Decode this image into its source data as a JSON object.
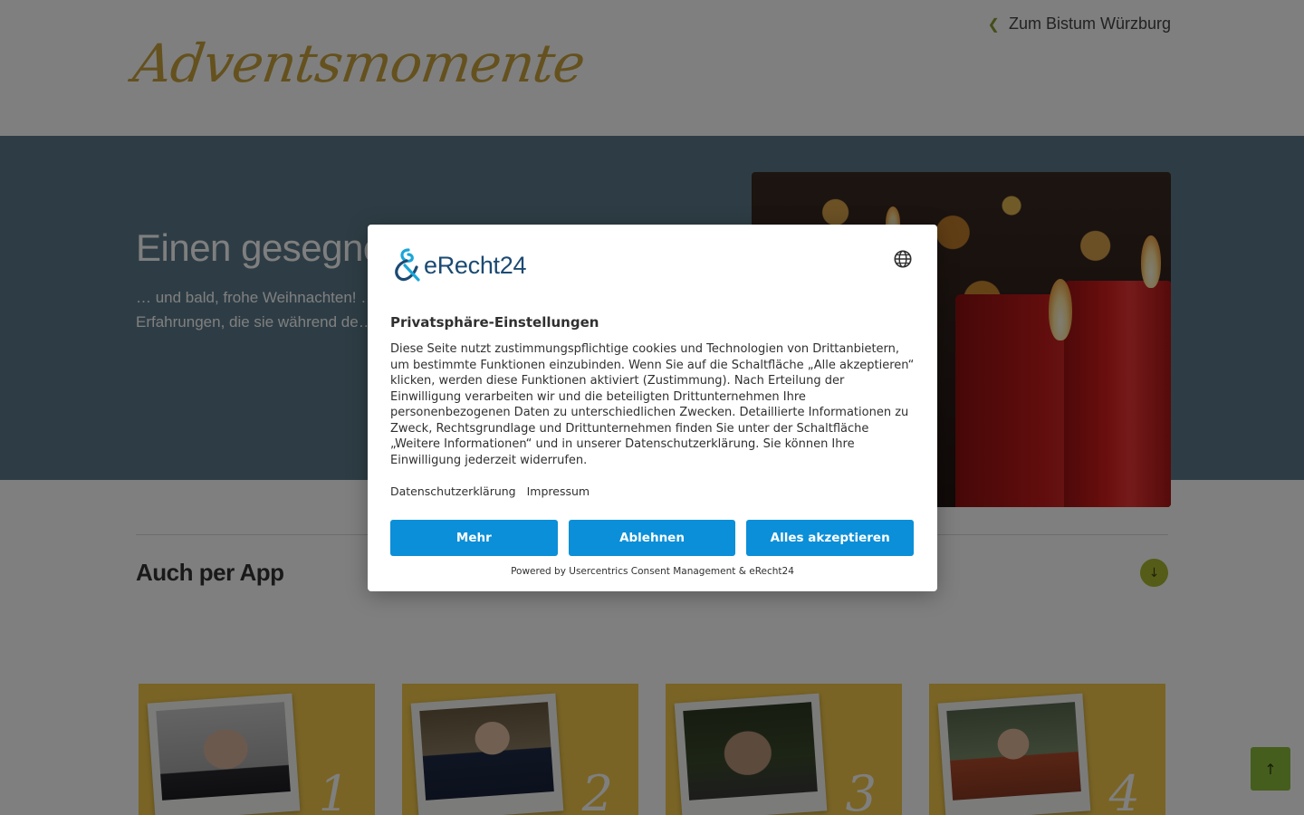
{
  "site": {
    "logo_text": "Adventsmomente",
    "back_link": "Zum Bistum Würzburg",
    "back_icon": "chevron-left-icon"
  },
  "hero": {
    "title": "Einen gesegneten",
    "text": "… und bald, frohe Weihnachten! … berichten Seelsorgerinnen und S… Erfahrungen, die sie während de… einen Hauch von Advent und We…"
  },
  "section": {
    "title": "Auch per App",
    "toggle_icon": "arrow-down-icon"
  },
  "cards": [
    {
      "number": "1"
    },
    {
      "number": "2"
    },
    {
      "number": "3"
    },
    {
      "number": "4"
    }
  ],
  "scroll_top_icon": "arrow-up-icon",
  "consent": {
    "brand": "eRecht24",
    "language_icon": "globe-icon",
    "title": "Privatsphäre-Einstellungen",
    "body": "Diese Seite nutzt zustimmungspflichtige cookies und Technologien von Drittanbietern, um bestimmte Funktionen einzubinden. Wenn Sie auf die Schaltfläche „Alle akzeptieren“ klicken, werden diese Funktionen aktiviert (Zustimmung). Nach Erteilung der Einwilligung verarbeiten wir und die beteiligten Drittunternehmen Ihre personenbezogenen Daten zu unterschiedlichen Zwecken. Detaillierte Informationen zu Zweck, Rechtsgrundlage und Drittunternehmen finden Sie unter der Schaltfläche „Weitere Informationen“ und in unserer Datenschutzerklärung. Sie können Ihre Einwilligung jederzeit widerrufen.",
    "links": {
      "privacy": "Datenschutzerklärung",
      "imprint": "Impressum"
    },
    "buttons": {
      "more": "Mehr",
      "deny": "Ablehnen",
      "accept": "Alles akzeptieren"
    },
    "powered_by": "Powered by Usercentrics Consent Management & eRecht24",
    "accent_color": "#0b8fd8"
  }
}
